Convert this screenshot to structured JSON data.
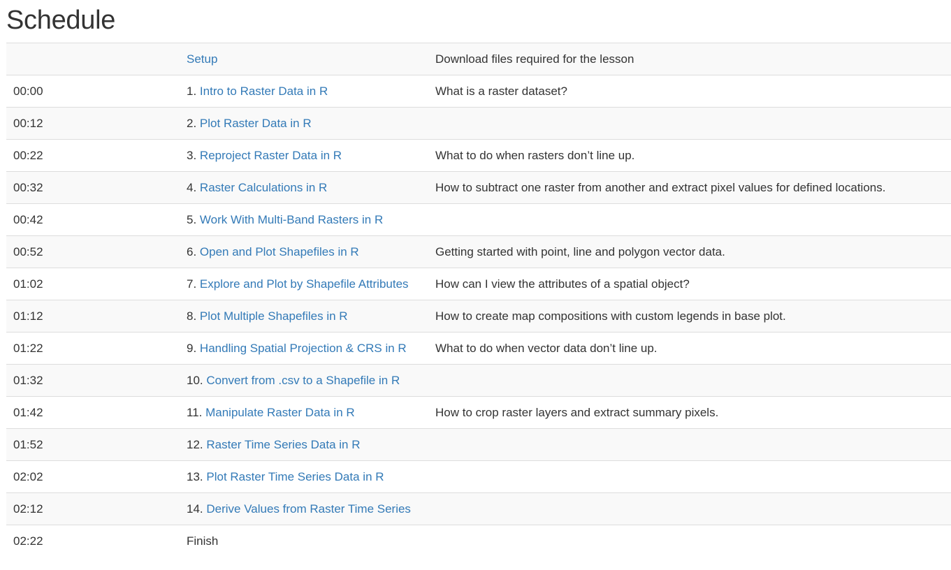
{
  "heading": "Schedule",
  "rows": [
    {
      "time": "",
      "number": "",
      "episode": "Setup",
      "linked": true,
      "question": "Download files required for the lesson"
    },
    {
      "time": "00:00",
      "number": "1.",
      "episode": "Intro to Raster Data in R",
      "linked": true,
      "question": "What is a raster dataset?"
    },
    {
      "time": "00:12",
      "number": "2.",
      "episode": "Plot Raster Data in R",
      "linked": true,
      "question": ""
    },
    {
      "time": "00:22",
      "number": "3.",
      "episode": "Reproject Raster Data in R",
      "linked": true,
      "question": "What to do when rasters don’t line up."
    },
    {
      "time": "00:32",
      "number": "4.",
      "episode": "Raster Calculations in R",
      "linked": true,
      "question": "How to subtract one raster from another and extract pixel values for defined locations."
    },
    {
      "time": "00:42",
      "number": "5.",
      "episode": "Work With Multi-Band Rasters in R",
      "linked": true,
      "question": ""
    },
    {
      "time": "00:52",
      "number": "6.",
      "episode": "Open and Plot Shapefiles in R",
      "linked": true,
      "question": "Getting started with point, line and polygon vector data."
    },
    {
      "time": "01:02",
      "number": "7.",
      "episode": "Explore and Plot by Shapefile Attributes",
      "linked": true,
      "question": "How can I view the attributes of a spatial object?"
    },
    {
      "time": "01:12",
      "number": "8.",
      "episode": "Plot Multiple Shapefiles in R",
      "linked": true,
      "question": "How to create map compositions with custom legends in base plot."
    },
    {
      "time": "01:22",
      "number": "9.",
      "episode": "Handling Spatial Projection & CRS in R",
      "linked": true,
      "question": "What to do when vector data don’t line up."
    },
    {
      "time": "01:32",
      "number": "10.",
      "episode": "Convert from .csv to a Shapefile in R",
      "linked": true,
      "question": ""
    },
    {
      "time": "01:42",
      "number": "11.",
      "episode": "Manipulate Raster Data in R",
      "linked": true,
      "question": "How to crop raster layers and extract summary pixels."
    },
    {
      "time": "01:52",
      "number": "12.",
      "episode": "Raster Time Series Data in R",
      "linked": true,
      "question": ""
    },
    {
      "time": "02:02",
      "number": "13.",
      "episode": "Plot Raster Time Series Data in R",
      "linked": true,
      "question": ""
    },
    {
      "time": "02:12",
      "number": "14.",
      "episode": "Derive Values from Raster Time Series",
      "linked": true,
      "question": ""
    },
    {
      "time": "02:22",
      "number": "",
      "episode": "Finish",
      "linked": false,
      "question": ""
    }
  ],
  "colors": {
    "link": "#337ab7",
    "text": "#333333",
    "stripe": "#f9f9f9",
    "border": "#dddddd"
  }
}
